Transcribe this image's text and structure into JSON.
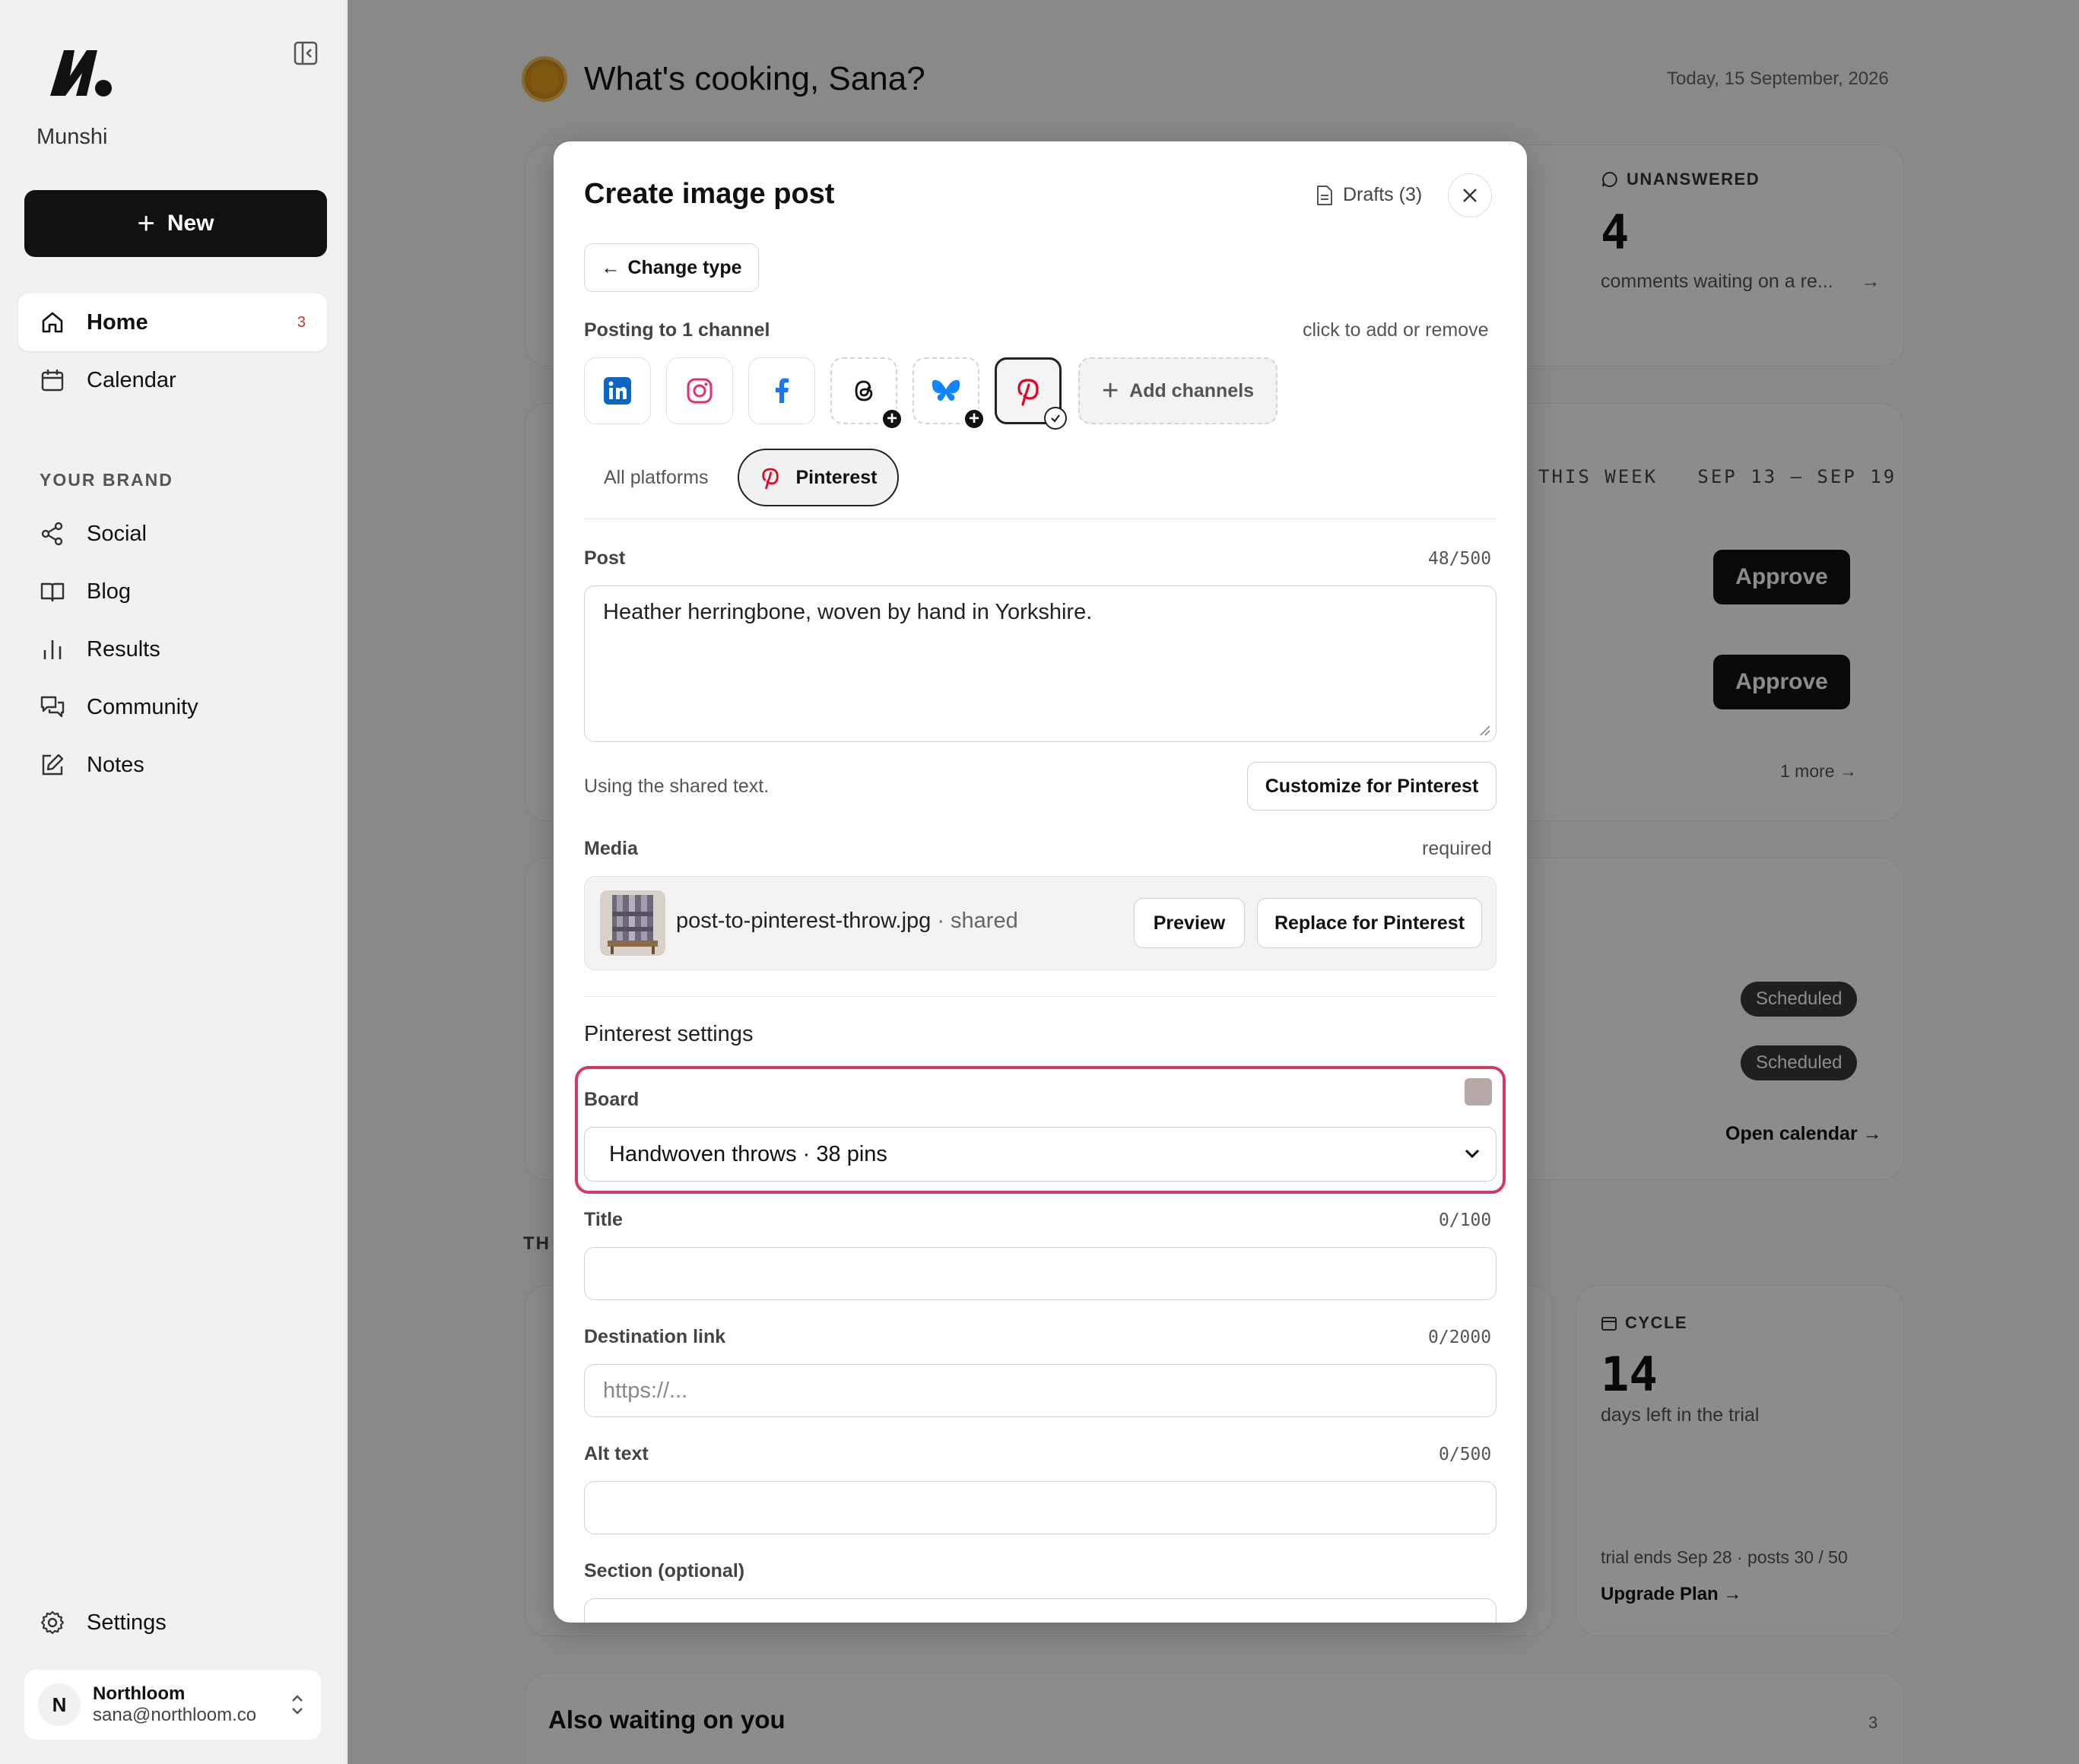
{
  "sidebar": {
    "brand": "Munshi",
    "new_label": "New",
    "nav": [
      {
        "label": "Home",
        "badge": "3"
      },
      {
        "label": "Calendar"
      }
    ],
    "section_label": "YOUR BRAND",
    "brand_nav": [
      {
        "label": "Social"
      },
      {
        "label": "Blog"
      },
      {
        "label": "Results"
      },
      {
        "label": "Community"
      },
      {
        "label": "Notes"
      }
    ],
    "settings_label": "Settings",
    "account": {
      "initial": "N",
      "name": "Northloom",
      "email": "sana@northloom.co"
    }
  },
  "dashboard": {
    "greeting": "What's cooking, Sana?",
    "date": "Today, 15 September, 2026",
    "unanswered": {
      "label": "UNANSWERED",
      "count": "4",
      "text": "comments waiting on a re..."
    },
    "week": {
      "label": "THIS WEEK",
      "range": "SEP 13 – SEP 19",
      "approve": "Approve",
      "more": "1 more"
    },
    "schedule": {
      "badge": "Scheduled",
      "open_calendar": "Open calendar →"
    },
    "section_prefix": "TH",
    "cycle": {
      "label": "CYCLE",
      "count": "14",
      "text": "days left in the trial",
      "footer": "trial ends Sep 28 · posts 30 / 50",
      "upgrade": "Upgrade Plan →"
    },
    "also_waiting": {
      "title": "Also waiting on you",
      "count": "3"
    }
  },
  "modal": {
    "title": "Create image post",
    "drafts": "Drafts (3)",
    "change_type": "Change type",
    "posting_to": "Posting to 1 channel",
    "channels_hint": "click to add or remove",
    "channels": [
      "linkedin-icon",
      "instagram-icon",
      "facebook-icon",
      "threads-icon",
      "bluesky-icon",
      "pinterest-icon"
    ],
    "add_channels": "Add channels",
    "tabs": {
      "all": "All platforms",
      "active": "Pinterest"
    },
    "post": {
      "label": "Post",
      "counter": "48/500",
      "value": "Heather herringbone, woven by hand in Yorkshire."
    },
    "shared_hint": "Using the shared text.",
    "customize": "Customize for Pinterest",
    "media": {
      "label": "Media",
      "required": "required",
      "filename": "post-to-pinterest-throw.jpg",
      "shared": " · shared",
      "preview": "Preview",
      "replace": "Replace for Pinterest"
    },
    "settings_title": "Pinterest settings",
    "board": {
      "label": "Board",
      "value": "Handwoven throws · 38 pins"
    },
    "title_field": {
      "label": "Title",
      "counter": "0/100"
    },
    "link": {
      "label": "Destination link",
      "counter": "0/2000",
      "placeholder": "https://..."
    },
    "alt": {
      "label": "Alt text",
      "counter": "0/500"
    },
    "section": {
      "label": "Section (optional)"
    }
  },
  "colors": {
    "accent_highlight": "#d63864",
    "pinterest": "#e60023",
    "linkedin": "#0a66c2",
    "facebook": "#1877f2",
    "bluesky": "#1185fe",
    "instagram": "#e1306c"
  }
}
